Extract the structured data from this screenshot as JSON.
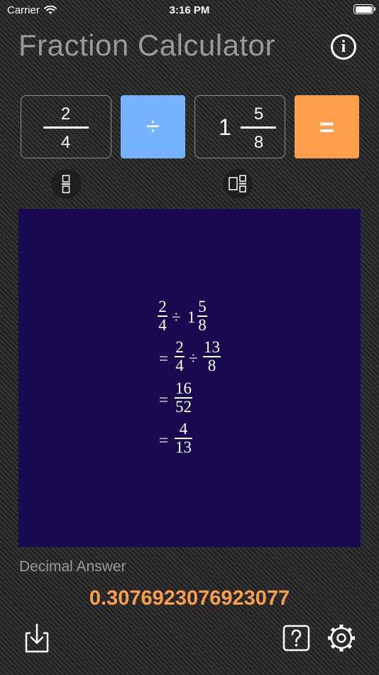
{
  "status_bar": {
    "carrier": "Carrier",
    "time": "3:16 PM"
  },
  "header": {
    "title": "Fraction Calculator",
    "info_icon": "info-icon"
  },
  "input": {
    "first_fraction": {
      "numerator": "2",
      "denominator": "4"
    },
    "operator": "÷",
    "second_fraction": {
      "whole": "1",
      "numerator": "5",
      "denominator": "8"
    },
    "equals_label": "="
  },
  "toggles": {
    "first": "fraction-mode-icon",
    "second": "mixed-number-mode-icon"
  },
  "solution_steps": {
    "line1": {
      "a_num": "2",
      "a_den": "4",
      "op": "÷",
      "b_whole": "1",
      "b_num": "5",
      "b_den": "8"
    },
    "line2": {
      "eq": "=",
      "a_num": "2",
      "a_den": "4",
      "op": "÷",
      "b_num": "13",
      "b_den": "8"
    },
    "line3": {
      "eq": "=",
      "num": "16",
      "den": "52"
    },
    "line4": {
      "eq": "=",
      "num": "4",
      "den": "13"
    }
  },
  "decimal": {
    "label": "Decimal Answer",
    "value": "0.3076923076923077"
  },
  "toolbar": {
    "export_icon": "export-icon",
    "help_icon": "help-icon",
    "settings_icon": "settings-icon"
  },
  "colors": {
    "background": "#2a2a2a",
    "operator_button": "#77b2ff",
    "equals_button": "#ff9f4d",
    "solution_panel": "#170a4e",
    "decimal_value": "#ff9f4d",
    "title_text": "#9a9a9a"
  }
}
